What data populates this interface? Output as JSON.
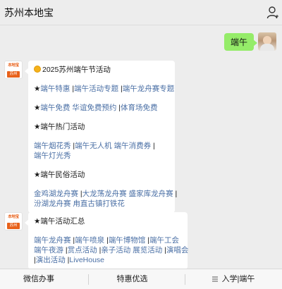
{
  "header": {
    "title": "苏州本地宝"
  },
  "user_message": {
    "text": "端午"
  },
  "bot": {
    "avatar_top": "本地宝",
    "avatar_bottom": "苏州"
  },
  "message1": {
    "title": "2025苏州端午节活动",
    "sec1": {
      "head": "★",
      "links": [
        "端午特惠",
        "端午活动专题",
        "端午龙舟赛专题"
      ]
    },
    "sec2": {
      "head": "★",
      "links": [
        "端午免费 华谊免费预约",
        "体育场免费"
      ]
    },
    "sec3": {
      "head": "★端午热门活动",
      "links": [
        "端午烟花秀",
        "端午无人机 端午消费券",
        "端午灯光秀"
      ]
    },
    "sec4": {
      "head": "★端午民俗活动",
      "links": [
        "金鸡湖龙舟赛",
        "大龙荡龙舟赛 盛家库龙舟赛",
        "汾湖龙舟赛 甪直古镇打铁花"
      ]
    }
  },
  "message2": {
    "head": "★端午活动汇总",
    "links": [
      "端午龙舟赛",
      "端午喷泉",
      "端午博物馆",
      "端午工会",
      "端午夜游",
      "赏点活动",
      "亲子活动",
      "展览活动",
      "演唱会",
      "演出活动",
      "LiveHouse"
    ]
  },
  "bottom_menu": {
    "items": [
      "微信办事",
      "特惠优选",
      "入学|端午"
    ]
  },
  "colors": {
    "link": "#4a6fa5",
    "bubble_me": "#95ec69",
    "brand": "#e8611a"
  }
}
